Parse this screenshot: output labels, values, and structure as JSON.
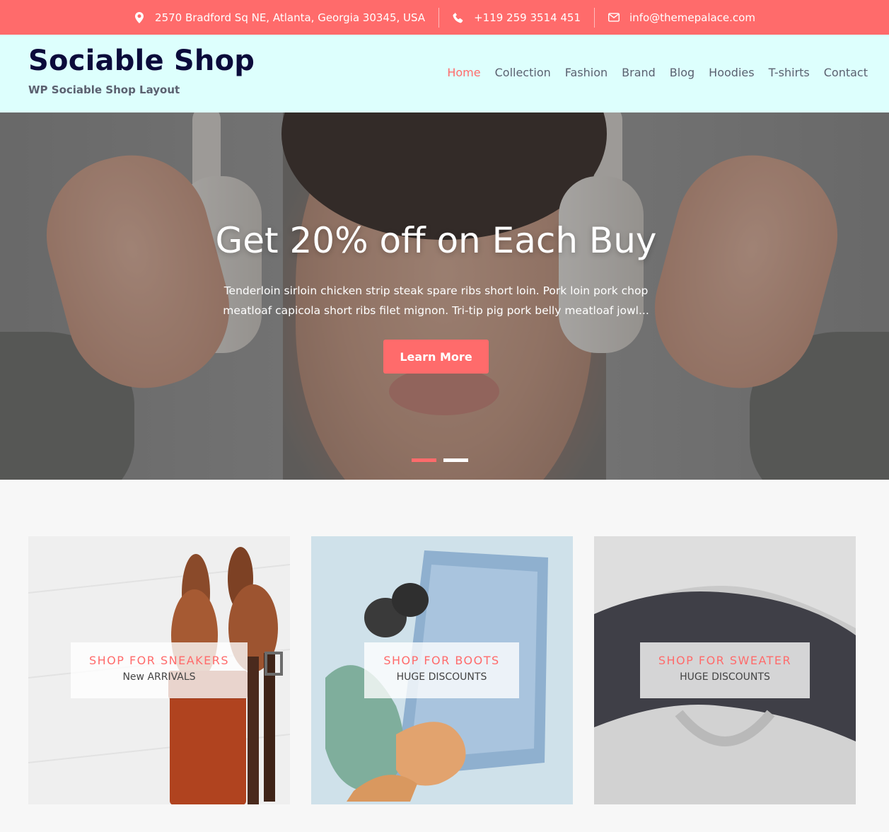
{
  "topbar": {
    "address": "2570 Bradford Sq NE, Atlanta, Georgia 30345, USA",
    "phone": "+119 259 3514 451",
    "email": "info@themepalace.com",
    "address_icon": "map-pin-icon",
    "phone_icon": "phone-icon",
    "email_icon": "envelope-icon"
  },
  "header": {
    "site_title": "Sociable Shop",
    "tagline": "WP Sociable Shop Layout"
  },
  "nav": {
    "items": [
      "Home",
      "Collection",
      "Fashion",
      "Brand",
      "Blog",
      "Hoodies",
      "T-shirts",
      "Contact"
    ],
    "active": "Home"
  },
  "hero": {
    "title": "Get 20% off on Each Buy",
    "description": "Tenderloin sirloin chicken strip steak spare ribs short loin. Pork loin pork chop meatloaf capicola short ribs filet mignon. Tri-tip pig pork belly meatloaf jowl...",
    "button_label": "Learn More",
    "slides_total": 2,
    "active_slide": 1
  },
  "promos": [
    {
      "title": "SHOP FOR SNEAKERS",
      "subtitle": "New ARRIVALS"
    },
    {
      "title": "SHOP FOR BOOTS",
      "subtitle": "HUGE DISCOUNTS"
    },
    {
      "title": "SHOP FOR SWEATER",
      "subtitle": "HUGE DISCOUNTS"
    }
  ],
  "colors": {
    "accent": "#ff6b6b",
    "header_bg": "#ddfffd",
    "title": "#0b0b3b",
    "nav_text": "#5b6170"
  }
}
